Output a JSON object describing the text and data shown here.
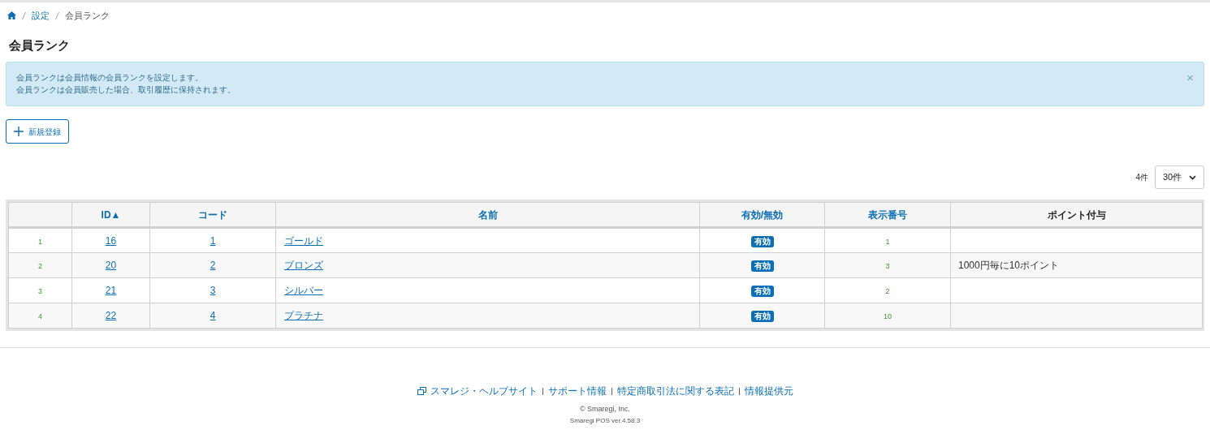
{
  "breadcrumb": [
    {
      "label": "設定",
      "link": true
    },
    {
      "label": "会員ランク",
      "link": false
    }
  ],
  "title": "会員ランク",
  "alert": {
    "lines": [
      "会員ランクは会員情報の会員ランクを設定します。",
      "会員ランクは会員販売した場合、取引履歴に保持されます。"
    ],
    "close": "×"
  },
  "new_button": "新規登録",
  "count": "4件",
  "per_page": {
    "value": "30件"
  },
  "table": {
    "columns": [
      {
        "label": "ID▲",
        "sortable": true
      },
      {
        "label": "コード",
        "sortable": true
      },
      {
        "label": "名前",
        "sortable": true
      },
      {
        "label": "有効/無効",
        "sortable": true
      },
      {
        "label": "表示番号",
        "sortable": true
      },
      {
        "label": "ポイント付与",
        "sortable": false
      }
    ],
    "rows": [
      {
        "no": "1",
        "id": "16",
        "code": "1",
        "name": "ゴールド",
        "status": "有効",
        "active": true,
        "order": "1"
      },
      {
        "no": "2",
        "id": "20",
        "code": "2",
        "name": "ブロンズ",
        "status": "有効",
        "active": true,
        "order": "3",
        "points": "1000円毎に10ポイント"
      },
      {
        "no": "3",
        "id": "21",
        "code": "3",
        "name": "シルバー",
        "status": "有効",
        "active": true,
        "order": "2"
      },
      {
        "no": "4",
        "id": "22",
        "code": "4",
        "name": "プラチナ",
        "status": "有効",
        "active": true,
        "order": "10"
      }
    ]
  },
  "footer": {
    "links": [
      "スマレジ・ヘルプサイト",
      "サポート情報",
      "特定商取引法に関する表記",
      "情報提供元"
    ],
    "copyright": "© Smaregi, Inc.",
    "version": "Smaregi POS ver.4.58.3"
  }
}
